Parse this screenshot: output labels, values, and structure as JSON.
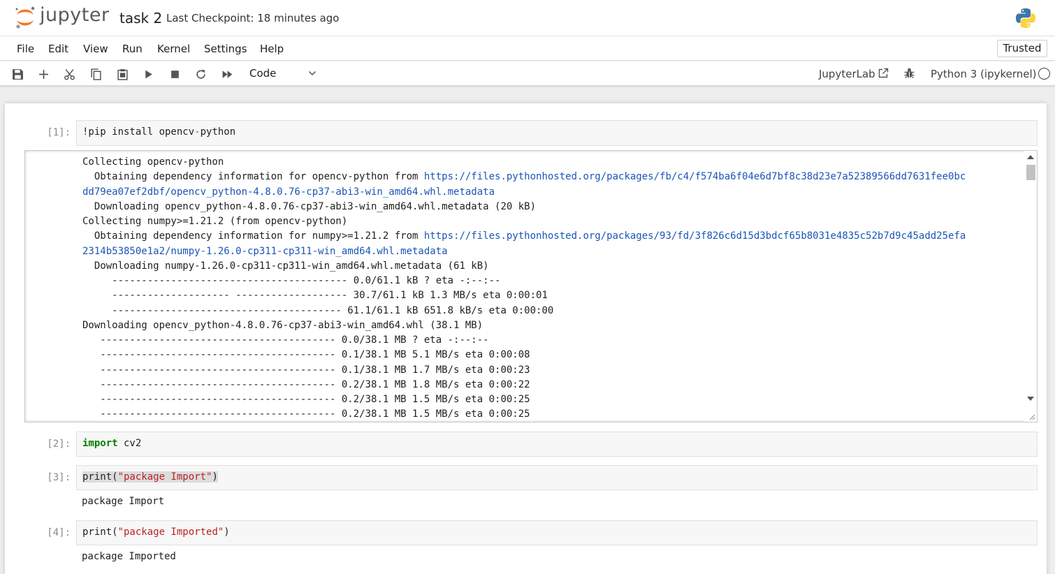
{
  "header": {
    "logo_text": "jupyter",
    "notebook_name": "task 2",
    "checkpoint": "Last Checkpoint: 18 minutes ago"
  },
  "menu": {
    "items": [
      "File",
      "Edit",
      "View",
      "Run",
      "Kernel",
      "Settings",
      "Help"
    ],
    "trusted": "Trusted"
  },
  "toolbar": {
    "icons": [
      "save-icon",
      "add-icon",
      "cut-icon",
      "copy-icon",
      "paste-icon",
      "run-icon",
      "stop-icon",
      "restart-icon",
      "fast-forward-icon"
    ],
    "cell_type": "Code",
    "jupyterlab_link": "JupyterLab",
    "kernel_name": "Python 3 (ipykernel)"
  },
  "colors": {
    "accent_orange": "#f37726",
    "link_blue": "#1a55b7",
    "keyword_green": "#008000",
    "string_red": "#ba2121"
  },
  "cells": [
    {
      "prompt": "[1]:",
      "source_parts": [
        "!pip install opencv",
        "-",
        "python"
      ],
      "output_lines": [
        [
          {
            "t": "Collecting opencv-python"
          }
        ],
        [
          {
            "t": "  Obtaining dependency information for opencv-python from "
          },
          {
            "t": "https://files.pythonhosted.org/packages/fb/c4/f574ba6f04e6d7bf8c38d23e7a52389566dd7631fee0bc",
            "link": true
          }
        ],
        [
          {
            "t": "dd79ea07ef2dbf/opencv_python-4.8.0.76-cp37-abi3-win_amd64.whl.metadata",
            "link": true
          }
        ],
        [
          {
            "t": "  Downloading opencv_python-4.8.0.76-cp37-abi3-win_amd64.whl.metadata (20 kB)"
          }
        ],
        [
          {
            "t": "Collecting numpy>=1.21.2 (from opencv-python)"
          }
        ],
        [
          {
            "t": "  Obtaining dependency information for numpy>=1.21.2 from "
          },
          {
            "t": "https://files.pythonhosted.org/packages/93/fd/3f826c6d15d3bdcf65b8031e4835c52b7d9c45add25efa",
            "link": true
          }
        ],
        [
          {
            "t": "2314b53850e1a2/numpy-1.26.0-cp311-cp311-win_amd64.whl.metadata",
            "link": true
          }
        ],
        [
          {
            "t": "  Downloading numpy-1.26.0-cp311-cp311-win_amd64.whl.metadata (61 kB)"
          }
        ],
        [
          {
            "t": "     ---------------------------------------- 0.0/61.1 kB ? eta -:--:--"
          }
        ],
        [
          {
            "t": "     -------------------- ------------------- 30.7/61.1 kB 1.3 MB/s eta 0:00:01"
          }
        ],
        [
          {
            "t": "     --------------------------------------- 61.1/61.1 kB 651.8 kB/s eta 0:00:00"
          }
        ],
        [
          {
            "t": "Downloading opencv_python-4.8.0.76-cp37-abi3-win_amd64.whl (38.1 MB)"
          }
        ],
        [
          {
            "t": "   ---------------------------------------- 0.0/38.1 MB ? eta -:--:--"
          }
        ],
        [
          {
            "t": "   ---------------------------------------- 0.1/38.1 MB 5.1 MB/s eta 0:00:08"
          }
        ],
        [
          {
            "t": "   ---------------------------------------- 0.1/38.1 MB 1.7 MB/s eta 0:00:23"
          }
        ],
        [
          {
            "t": "   ---------------------------------------- 0.2/38.1 MB 1.8 MB/s eta 0:00:22"
          }
        ],
        [
          {
            "t": "   ---------------------------------------- 0.2/38.1 MB 1.5 MB/s eta 0:00:25"
          }
        ],
        [
          {
            "t": "   ---------------------------------------- 0.2/38.1 MB 1.5 MB/s eta 0:00:25"
          }
        ]
      ]
    },
    {
      "prompt": "[2]:",
      "source_keyword": "import",
      "source_rest": " cv2"
    },
    {
      "prompt": "[3]:",
      "source_func": "print(",
      "source_string": "\"package Import\"",
      "source_close": ")",
      "output": "package Import"
    },
    {
      "prompt": "[4]:",
      "source_func": "print(",
      "source_string": "\"package Imported\"",
      "source_close": ")",
      "output": "package Imported"
    }
  ]
}
